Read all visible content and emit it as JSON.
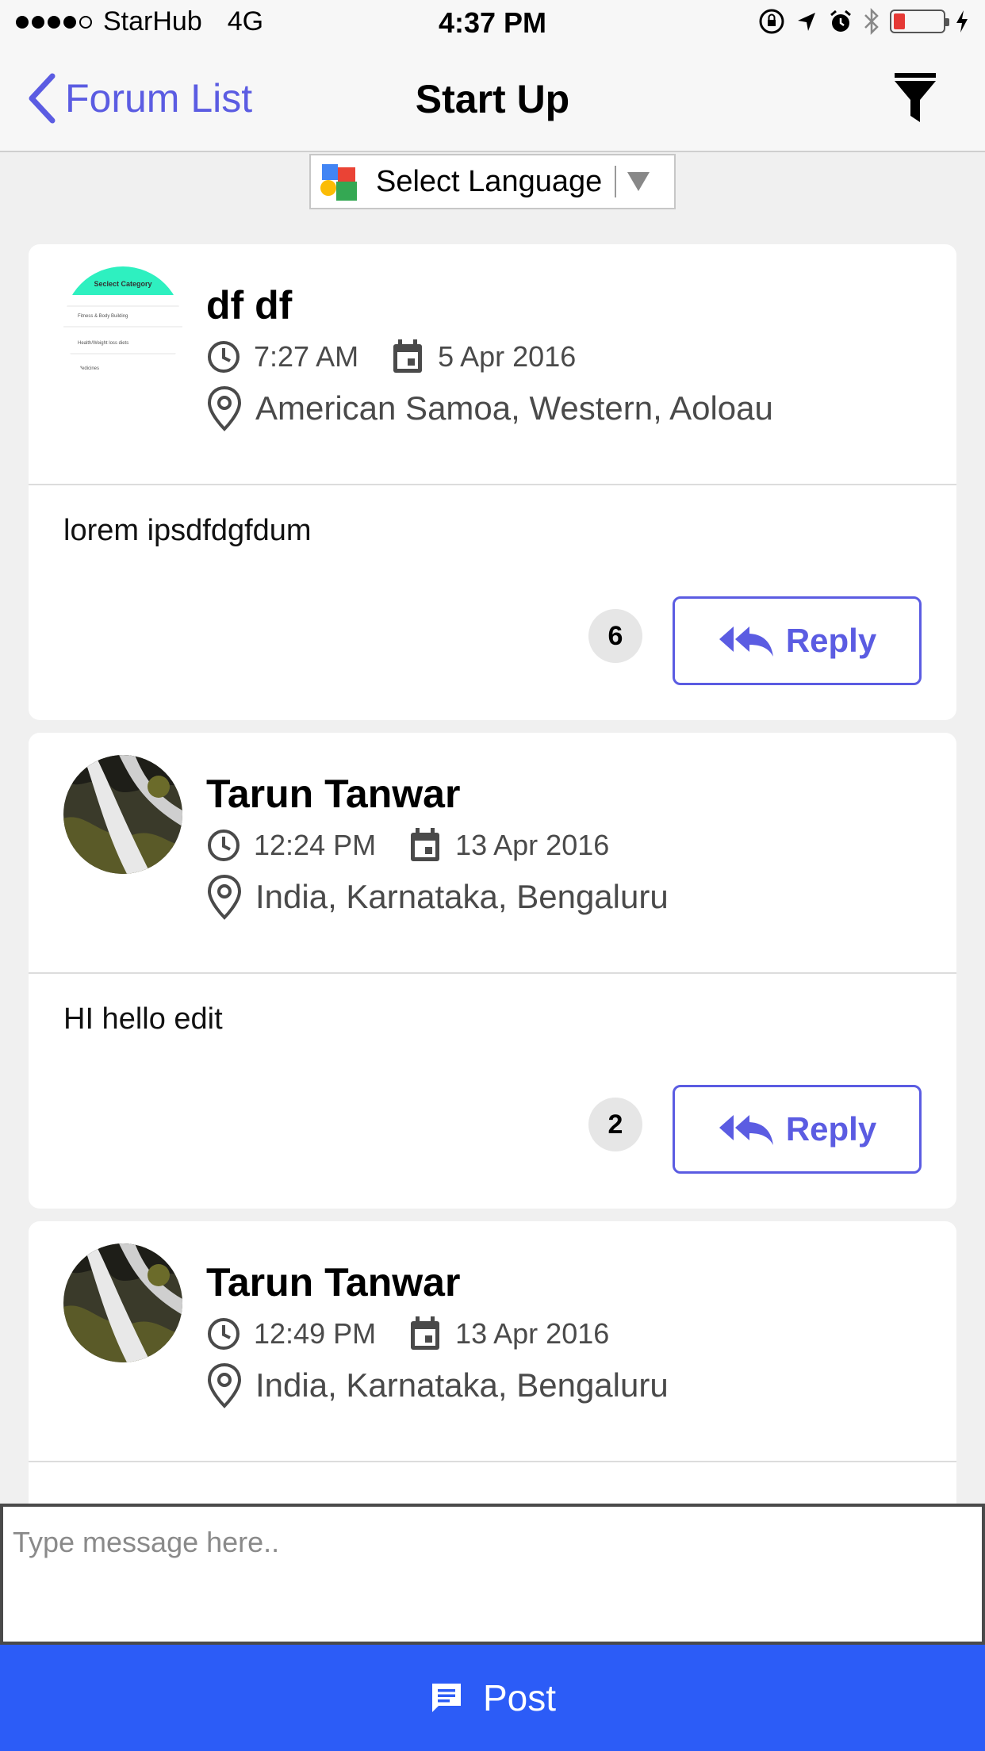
{
  "status_bar": {
    "carrier": "StarHub",
    "network": "4G",
    "time": "4:37 PM"
  },
  "nav": {
    "back_label": "Forum List",
    "title": "Start Up"
  },
  "language": {
    "label": "Select Language"
  },
  "posts": [
    {
      "author": "df df",
      "time": "7:27 AM",
      "date": "5 Apr 2016",
      "location": "American Samoa, Western, Aoloau",
      "message": "lorem ipsdfdgfdum",
      "reply_count": "6",
      "reply_label": "Reply",
      "avatar_text": {
        "title": "Seclect Category",
        "items": [
          "Fitness & Body Building",
          "Health/Weight loss diets",
          "Medicines"
        ]
      }
    },
    {
      "author": "Tarun Tanwar",
      "time": "12:24 PM",
      "date": "13 Apr 2016",
      "location": "India, Karnataka, Bengaluru",
      "message": "HI hello edit",
      "reply_count": "2",
      "reply_label": "Reply"
    },
    {
      "author": "Tarun Tanwar",
      "time": "12:49 PM",
      "date": "13 Apr 2016",
      "location": "India, Karnataka, Bengaluru"
    }
  ],
  "composer": {
    "placeholder": "Type message here..",
    "post_label": "Post"
  },
  "colors": {
    "accent": "#5b5ce2",
    "post_button": "#2c5cf7",
    "avatar_header": "#2ef0c0",
    "battery_low": "#e53935"
  },
  "icons": [
    "back-chevron-icon",
    "filter-icon",
    "clock-icon",
    "calendar-icon",
    "location-pin-icon",
    "reply-all-icon",
    "message-icon",
    "google-translate-icon",
    "dropdown-arrow-icon"
  ]
}
